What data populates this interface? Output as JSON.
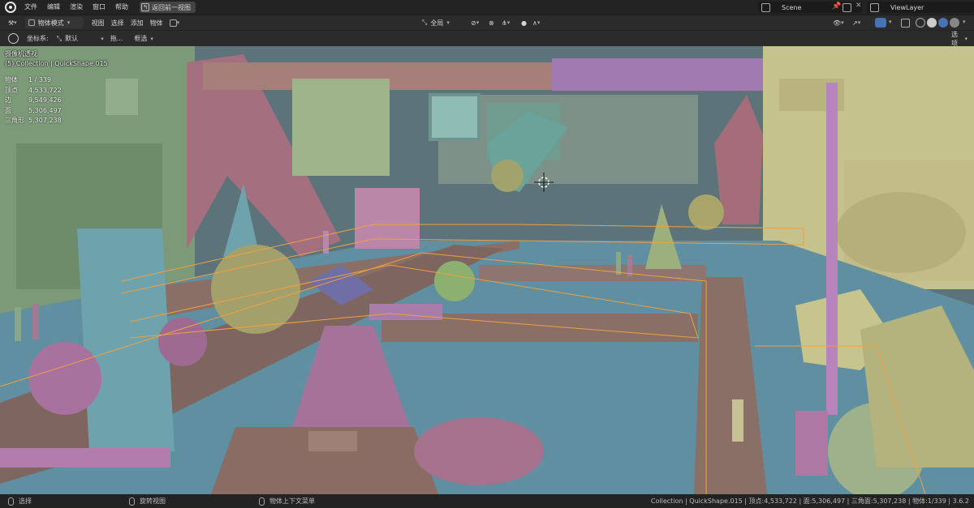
{
  "menubar": {
    "items": [
      "文件",
      "编辑",
      "渲染",
      "窗口",
      "帮助"
    ],
    "back_button": "返回前一视图",
    "scene": "Scene",
    "view_layer": "ViewLayer"
  },
  "toolbar": {
    "mode": "物体模式",
    "menus": [
      "视图",
      "选择",
      "添加",
      "物体"
    ],
    "transform_orientation": "全局"
  },
  "header": {
    "coord_label": "坐标系:",
    "coord_value": "默认",
    "drag_label": "拖...",
    "select_mode": "框选",
    "options": "选项"
  },
  "viewport": {
    "view_name": "摄像机透视",
    "collection_info": "(5) Collection | QuickShape.015",
    "stats": [
      {
        "label": "物体",
        "value": "1 / 339"
      },
      {
        "label": "顶点",
        "value": "4,533,722"
      },
      {
        "label": "边",
        "value": "9,549,426"
      },
      {
        "label": "面",
        "value": "5,306,497"
      },
      {
        "label": "三角形",
        "value": "5,307,238"
      }
    ]
  },
  "statusbar": {
    "select": "选择",
    "rotate": "旋转视图",
    "context": "物体上下文菜单",
    "info": "Collection | QuickShape.015 | 顶点:4,533,722 | 面:5,306,497 | 三角面:5,307,238 | 物体:1/339 | 3.6.2"
  },
  "colors": {
    "teal": "#5f8fa0",
    "pink": "#a8708f",
    "green": "#8fa87a",
    "tan": "#8a6f66",
    "yellow": "#c7c48d",
    "violet": "#9d79b4",
    "selection": "#f0a040"
  }
}
